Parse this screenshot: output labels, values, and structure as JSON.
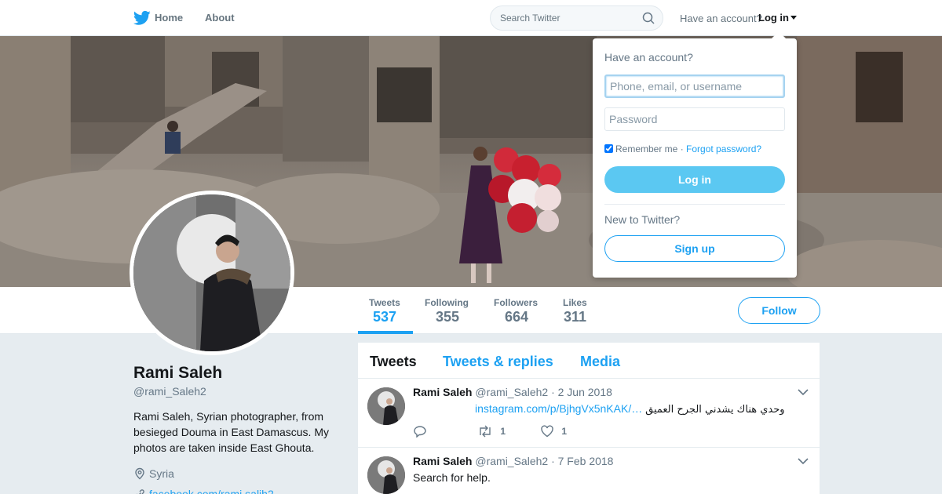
{
  "nav": {
    "home_label": "Home",
    "about_label": "About",
    "search_placeholder": "Search Twitter",
    "have_account_text": "Have an account?",
    "login_label": "Log in"
  },
  "profile": {
    "name": "Rami Saleh",
    "handle": "@rami_Saleh2",
    "bio": "Rami Saleh, Syrian photographer, from besieged Douma in East Damascus. My photos are taken inside East Ghouta.",
    "location": "Syria",
    "link": "facebook.com/rami.salih2"
  },
  "stats": [
    {
      "label": "Tweets",
      "value": "537",
      "active": true
    },
    {
      "label": "Following",
      "value": "355",
      "active": false
    },
    {
      "label": "Followers",
      "value": "664",
      "active": false
    },
    {
      "label": "Likes",
      "value": "311",
      "active": false
    }
  ],
  "follow_label": "Follow",
  "timeline": {
    "tabs": [
      "Tweets",
      "Tweets & replies",
      "Media"
    ],
    "tweets": [
      {
        "name": "Rami Saleh",
        "handle": "@rami_Saleh2",
        "date": "· 2 Jun 2018",
        "link": "instagram.com/p/BjhgVx5nKAK/…",
        "text": "وحدي هناك يشدني الجرح العميق",
        "replies": "",
        "retweets": "1",
        "likes": "1"
      },
      {
        "name": "Rami Saleh",
        "handle": "@rami_Saleh2",
        "date": "· 7 Feb 2018",
        "text": "Search for help."
      }
    ]
  },
  "login_dropdown": {
    "title": "Have an account?",
    "username_placeholder": "Phone, email, or username",
    "password_placeholder": "Password",
    "remember_label": "Remember me",
    "separator": " · ",
    "forgot_label": "Forgot password?",
    "login_button": "Log in",
    "new_text": "New to Twitter?",
    "signup_button": "Sign up"
  },
  "colors": {
    "accent": "#1da1f2",
    "login_button_bg": "#5bc8f2",
    "background": "#e6ecf0"
  }
}
